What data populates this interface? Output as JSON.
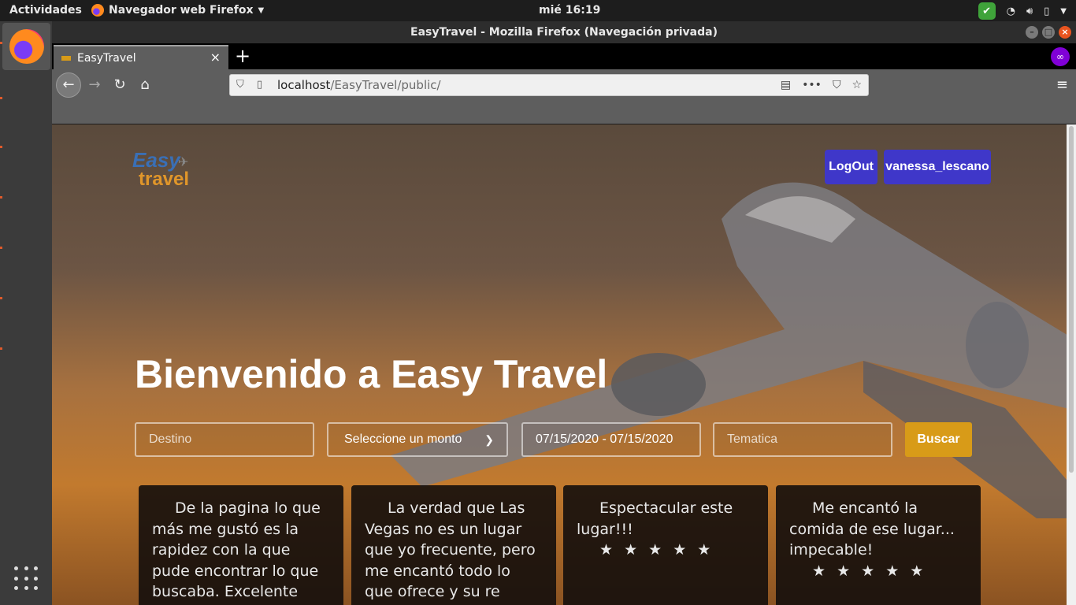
{
  "system": {
    "activities": "Actividades",
    "app_menu": "Navegador web Firefox",
    "clock": "mié 16:19"
  },
  "window": {
    "title": "EasyTravel - Mozilla Firefox (Navegación privada)"
  },
  "tab": {
    "title": "EasyTravel",
    "close": "×",
    "new_tab": "+"
  },
  "url": {
    "host": "localhost",
    "path": "/EasyTravel/public/"
  },
  "site": {
    "logo_line1": "Easy",
    "logo_line2": "travel",
    "logout": "LogOut",
    "username": "vanessa_lescano",
    "welcome": "Bienvenido a Easy Travel",
    "search": {
      "destino_placeholder": "Destino",
      "monto_selected": "Seleccione un monto",
      "fechas": "07/15/2020 - 07/15/2020",
      "tematica_placeholder": "Tematica",
      "buscar": "Buscar"
    },
    "reviews": [
      {
        "text": "De la pagina lo que más me gustó es la rapidez con la que pude encontrar lo que buscaba. Excelente",
        "stars": ""
      },
      {
        "text": "La verdad que Las Vegas no es un lugar que yo frecuente, pero me encantó todo lo que ofrece y su re",
        "stars": ""
      },
      {
        "text": "Espectacular este lugar!!!",
        "stars": "★ ★ ★ ★ ★"
      },
      {
        "text": "Me encantó la comida de ese lugar... impecable!",
        "stars": "★ ★ ★ ★ ★"
      }
    ]
  },
  "colors": {
    "button_primary": "#3f37c9",
    "button_search": "#d89b18",
    "logo_blue": "#3a6fb5",
    "logo_orange": "#e0962a"
  },
  "icons": [
    "firefox-icon",
    "check-icon",
    "wifi-icon",
    "volume-icon",
    "battery-icon",
    "back-icon",
    "forward-icon",
    "reload-icon",
    "home-icon",
    "shield-icon",
    "reader-icon",
    "more-icon",
    "pocket-icon",
    "star-icon",
    "menu-icon",
    "private-browsing-icon",
    "app-grid-icon",
    "chevron-down-icon"
  ]
}
